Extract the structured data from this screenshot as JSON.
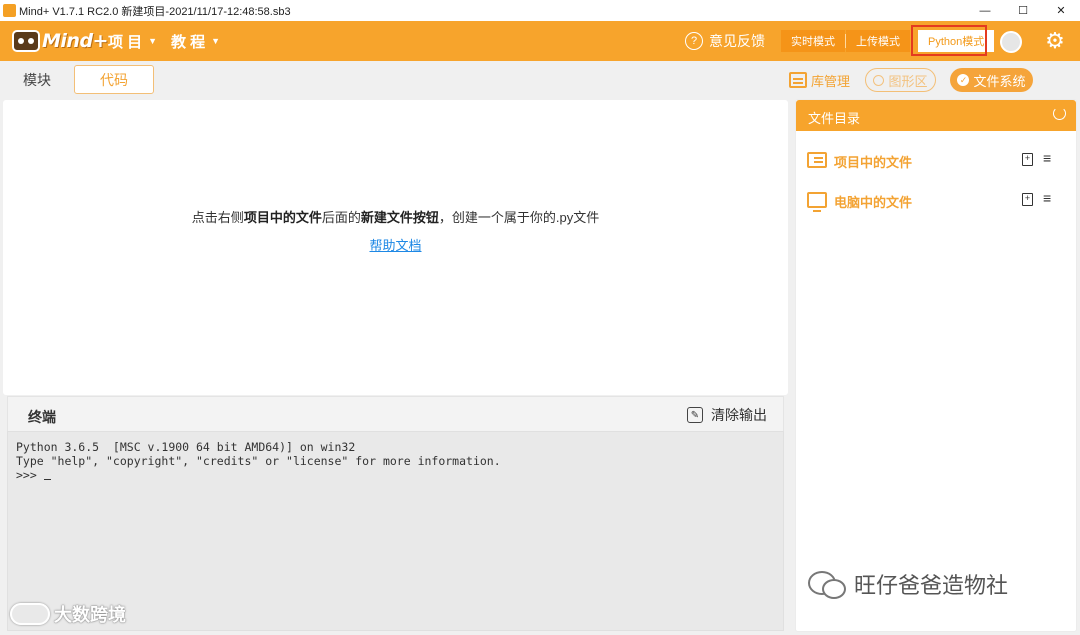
{
  "window": {
    "title": "Mind+ V1.7.1 RC2.0    新建项目-2021/11/17-12:48:58.sb3",
    "minimize": "—",
    "maximize": "☐",
    "close": "✕"
  },
  "header": {
    "logo_text": "Mind+",
    "menu": [
      {
        "label": "项 目",
        "caret": "▼"
      },
      {
        "label": "教 程",
        "caret": "▼"
      }
    ],
    "feedback_icon": "?",
    "feedback_label": "意见反馈",
    "modes": {
      "realtime": "实时模式",
      "upload": "上传模式",
      "python": "Python模式"
    },
    "settings_icon": "⚙"
  },
  "tabs": {
    "blocks": "模块",
    "code": "代码"
  },
  "toolbar": {
    "library_manager": "库管理",
    "graphics_area": "图形区",
    "file_system": "文件系统",
    "check_mark": "✓"
  },
  "editor": {
    "hint_part1": "点击右侧",
    "hint_bold1": "项目中的文件",
    "hint_part2": "后面的",
    "hint_bold2": "新建文件按钮",
    "hint_part3": "，创建一个属于你的.py文件",
    "help_link": "帮助文档"
  },
  "terminal": {
    "title": "终端",
    "clear_label": "清除输出",
    "clear_icon": "✎",
    "lines": [
      "Python 3.6.5  [MSC v.1900 64 bit AMD64)] on win32",
      "Type \"help\", \"copyright\", \"credits\" or \"license\" for more information.",
      ">>> "
    ]
  },
  "file_panel": {
    "title": "文件目录",
    "items": [
      {
        "label": "项目中的文件",
        "new_icon": "+",
        "menu_icon": "≡"
      },
      {
        "label": "电脑中的文件",
        "new_icon": "+",
        "menu_icon": "≡"
      }
    ]
  },
  "watermarks": {
    "wechat": "旺仔爸爸造物社",
    "bigdata": "大数跨境"
  },
  "colors": {
    "brand_orange": "#f7a42c",
    "accent_orange": "#f3a333",
    "highlight_red": "#e43a1f",
    "link_blue": "#1e88e5"
  }
}
